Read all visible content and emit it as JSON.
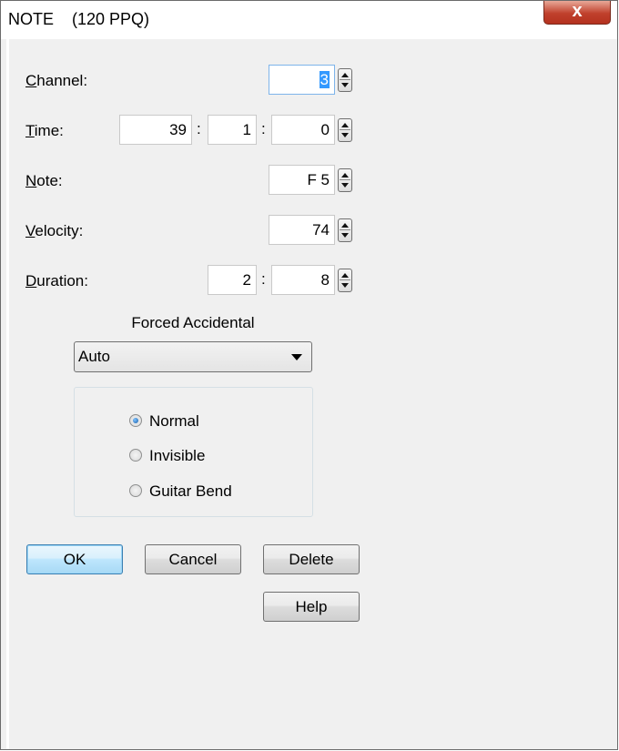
{
  "window": {
    "title": "NOTE    (120 PPQ)",
    "close_glyph": "x"
  },
  "fields": {
    "channel": {
      "label_mnemonic": "C",
      "label_rest": "hannel:",
      "value": "3"
    },
    "time": {
      "label_mnemonic": "T",
      "label_rest": "ime:",
      "bar": "39",
      "beat": "1",
      "tick": "0",
      "separator": ":"
    },
    "note": {
      "label_mnemonic": "N",
      "label_rest": "ote:",
      "value": "F 5"
    },
    "velocity": {
      "label_mnemonic": "V",
      "label_rest": "elocity:",
      "value": "74"
    },
    "duration": {
      "label_mnemonic": "D",
      "label_rest": "uration:",
      "beats": "2",
      "ticks": "8",
      "separator": ":"
    }
  },
  "forced_accidental": {
    "title": "Forced Accidental",
    "selected": "Auto"
  },
  "display_mode": {
    "options": [
      {
        "label": "Normal",
        "checked": true
      },
      {
        "label": "Invisible",
        "checked": false
      },
      {
        "label": "Guitar Bend",
        "checked": false
      }
    ]
  },
  "buttons": {
    "ok": "OK",
    "cancel": "Cancel",
    "delete": "Delete",
    "help": "Help"
  },
  "colors": {
    "selection": "#3399ff",
    "close_button": "#c0402c",
    "default_button_border": "#3c7fb1"
  }
}
